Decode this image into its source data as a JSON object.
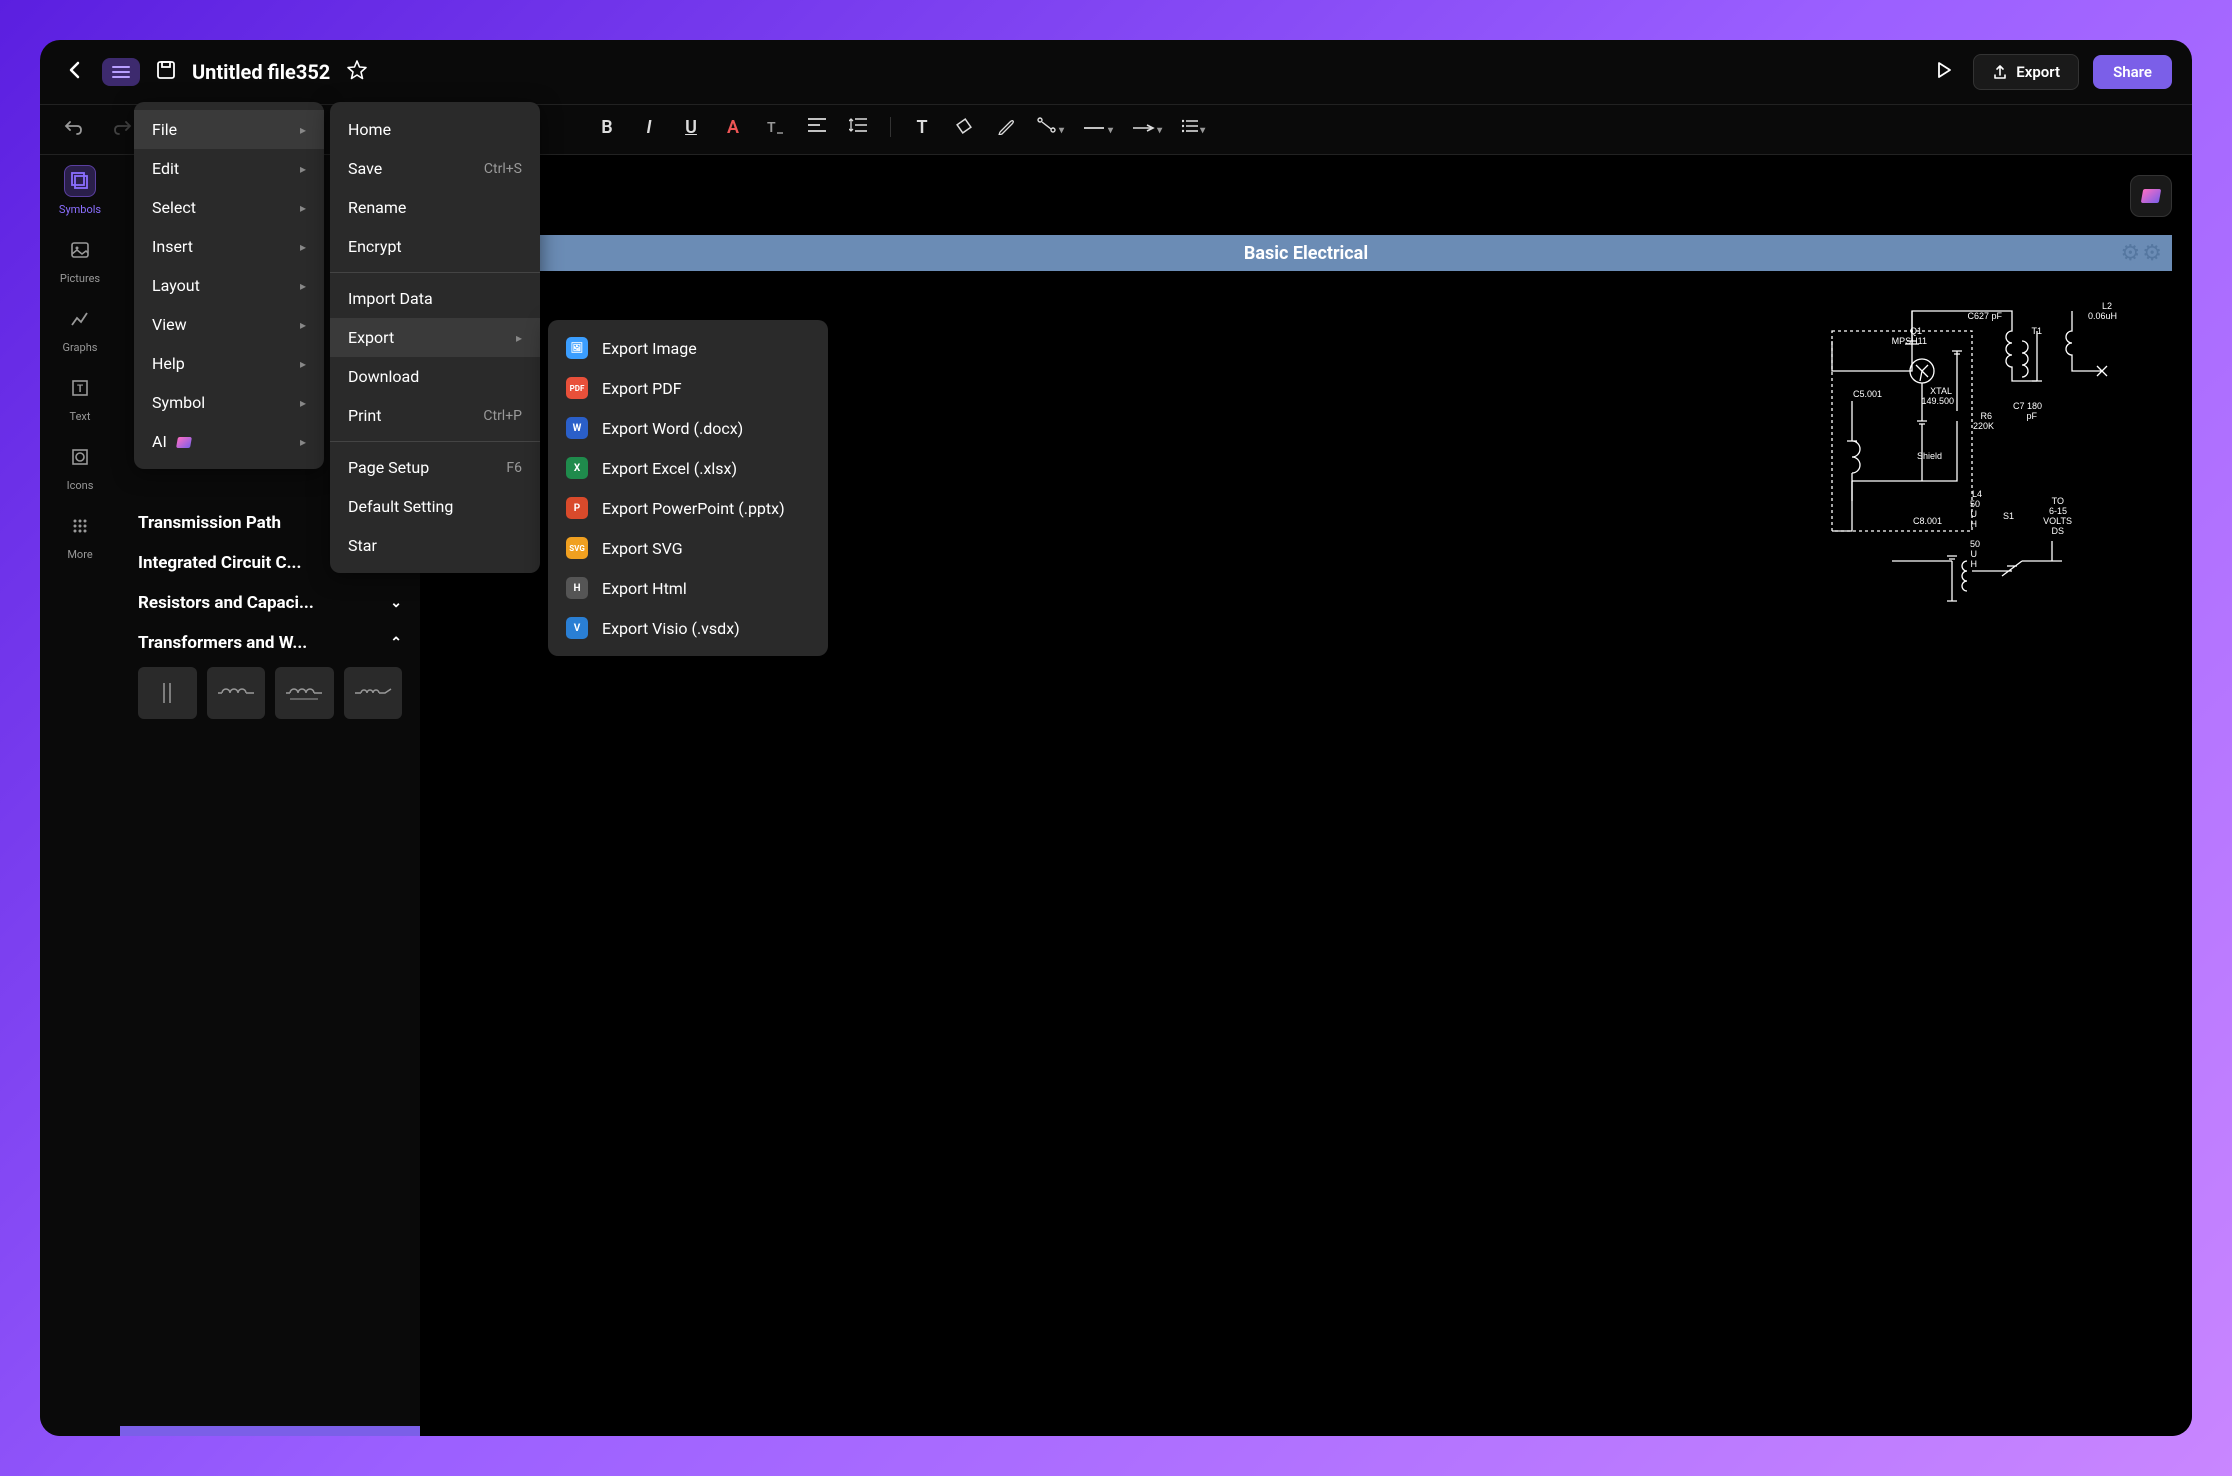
{
  "titlebar": {
    "file_title": "Untitled file352",
    "export_label": "Export",
    "share_label": "Share"
  },
  "left_rail": {
    "symbols": "Symbols",
    "pictures": "Pictures",
    "graphs": "Graphs",
    "text": "Text",
    "icons": "Icons",
    "more": "More"
  },
  "side_panel": {
    "transmission": "Transmission Path",
    "integrated": "Integrated Circuit C...",
    "resistors": "Resistors and Capaci...",
    "transformers": "Transformers and W..."
  },
  "menu1": {
    "file": "File",
    "edit": "Edit",
    "select": "Select",
    "insert": "Insert",
    "layout": "Layout",
    "view": "View",
    "help": "Help",
    "symbol": "Symbol",
    "ai": "AI"
  },
  "menu2": {
    "home": "Home",
    "save": "Save",
    "save_shortcut": "Ctrl+S",
    "rename": "Rename",
    "encrypt": "Encrypt",
    "import": "Import Data",
    "export": "Export",
    "download": "Download",
    "print": "Print",
    "print_shortcut": "Ctrl+P",
    "page_setup": "Page Setup",
    "page_setup_shortcut": "F6",
    "default_setting": "Default Setting",
    "star": "Star"
  },
  "menu3": {
    "export_image": "Export Image",
    "export_pdf": "Export PDF",
    "export_word": "Export Word (.docx)",
    "export_excel": "Export Excel (.xlsx)",
    "export_ppt": "Export PowerPoint (.pptx)",
    "export_svg": "Export SVG",
    "export_html": "Export Html",
    "export_visio": "Export Visio (.vsdx)"
  },
  "canvas": {
    "title": "Basic Electrical",
    "labels": {
      "q1": "Q1",
      "q1_part": "MPSH11",
      "c6": "C627 pF",
      "t1": "T1",
      "l2": "L2",
      "l2_val": "0.06uH",
      "c5": "C5.001",
      "xtal": "XTAL",
      "xtal_val": "149.500",
      "r6": "R6",
      "r6_val": "220K",
      "c7": "C7 180",
      "c7_unit": "pF",
      "shield": "Shield",
      "c8": "C8.001",
      "l4": "L4",
      "l4_val1": "50",
      "l4_val2": "U",
      "l4_val3": "H",
      "s1": "S1",
      "to": "TO",
      "volts": "6-15",
      "volts2": "VOLTS",
      "ds": "DS",
      "fifty": "50",
      "u": "U",
      "h": "H"
    }
  },
  "export_icons": {
    "img": "🖼",
    "pdf": "PDF",
    "word": "W",
    "excel": "X",
    "ppt": "P",
    "svg": "SVG",
    "html": "H",
    "visio": "V"
  }
}
